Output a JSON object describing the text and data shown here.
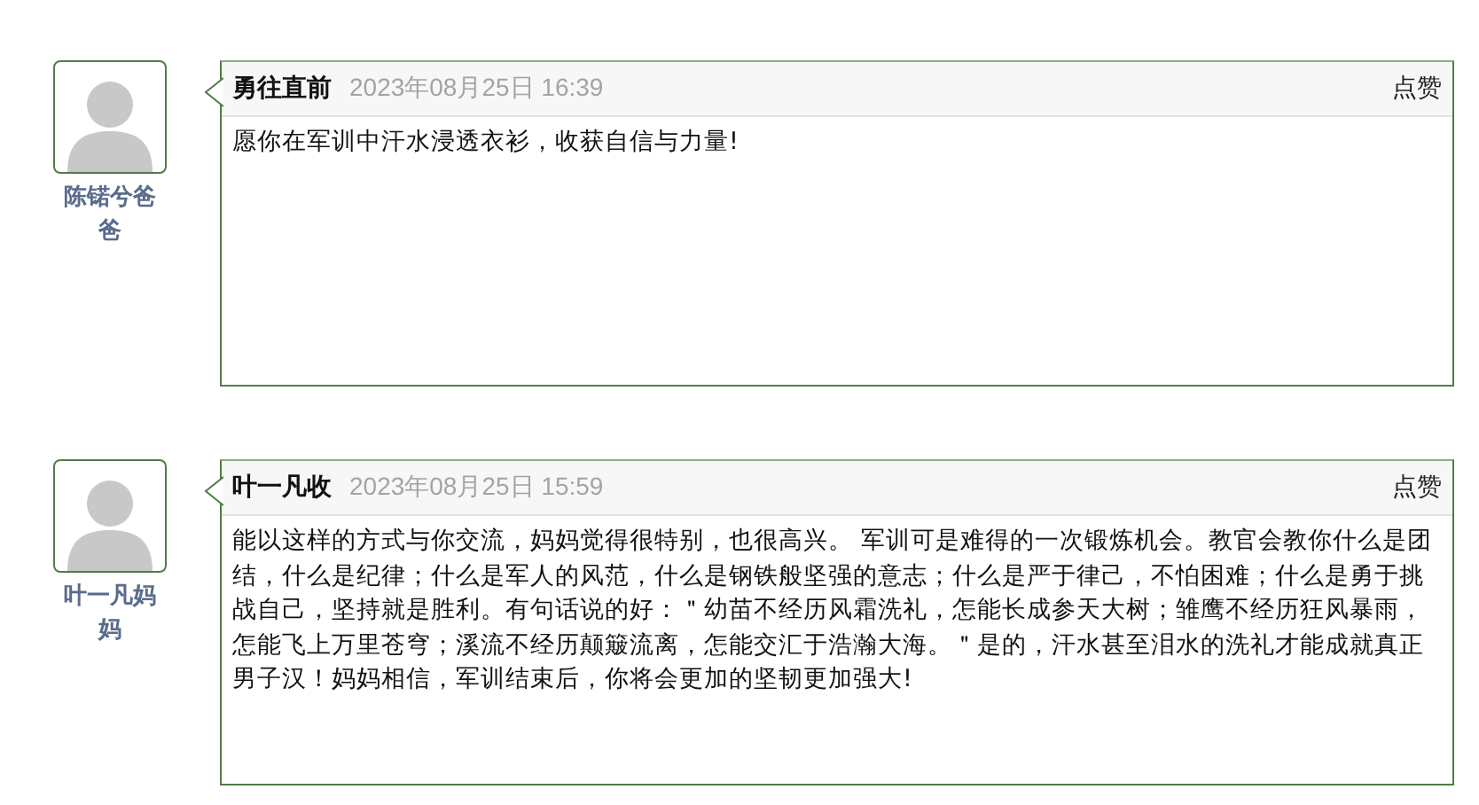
{
  "comments": [
    {
      "author": "陈锘兮爸爸",
      "title": "勇往直前",
      "time": "2023年08月25日 16:39",
      "like": "点赞",
      "body": "愿你在军训中汗水浸透衣衫，收获自信与力量!"
    },
    {
      "author": "叶一凡妈妈",
      "title": "叶一凡收",
      "time": "2023年08月25日 15:59",
      "like": "点赞",
      "body": "能以这样的方式与你交流，妈妈觉得很特别，也很高兴。 军训可是难得的一次锻炼机会。教官会教你什么是团结，什么是纪律；什么是军人的风范，什么是钢铁般坚强的意志；什么是严于律己，不怕困难；什么是勇于挑战自己，坚持就是胜利。有句话说的好：＂幼苗不经历风霜洗礼，怎能长成参天大树；雏鹰不经历狂风暴雨，怎能飞上万里苍穹；溪流不经历颠簸流离，怎能交汇于浩瀚大海。＂是的，汗水甚至泪水的洗礼才能成就真正男子汉！妈妈相信，军训结束后，你将会更加的坚韧更加强大!"
    }
  ]
}
